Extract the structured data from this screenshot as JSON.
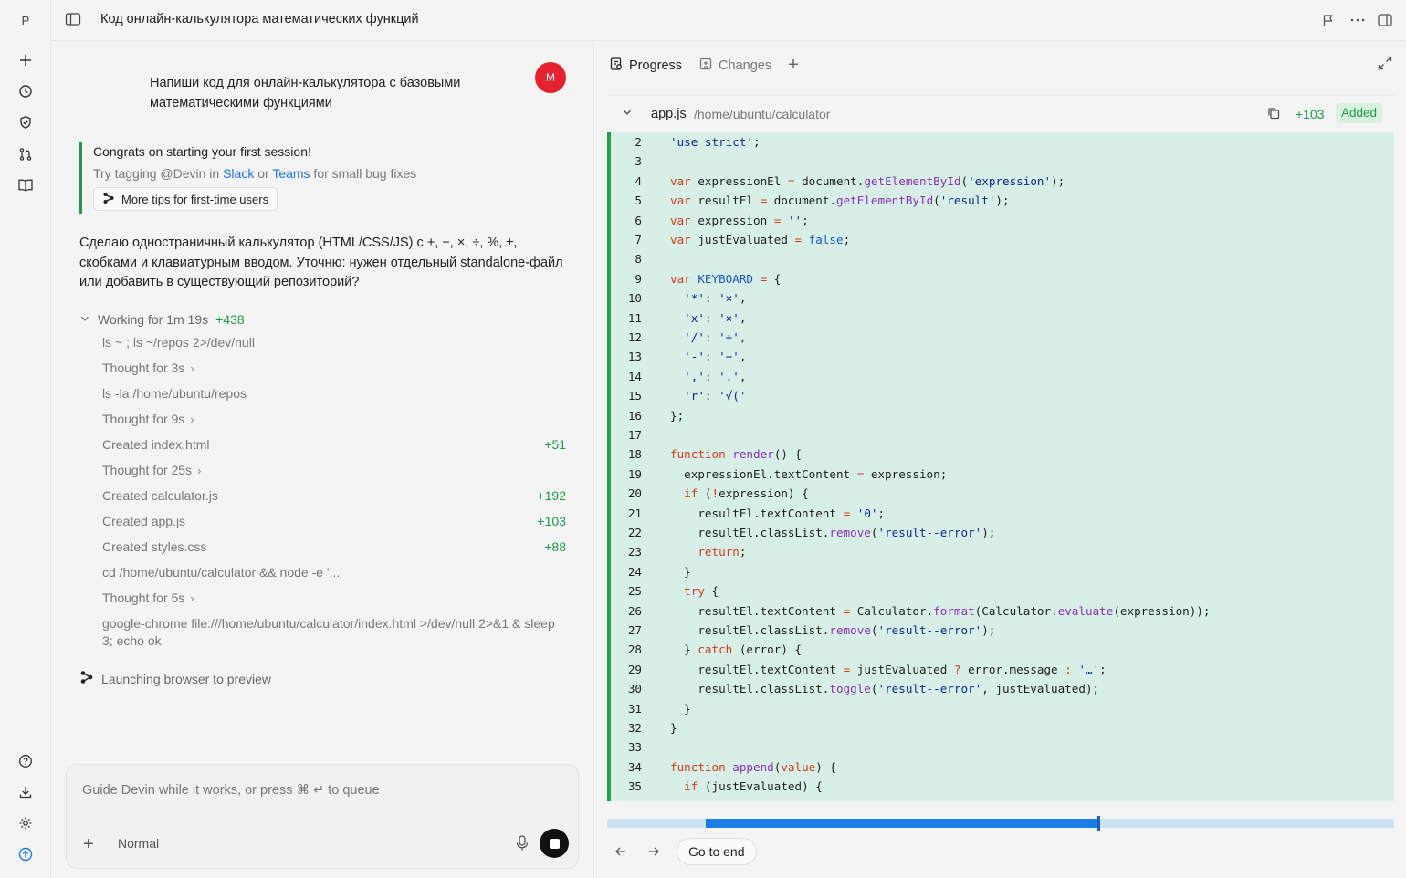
{
  "rail": {
    "workspace_letter": "P",
    "icons": [
      "plus-icon",
      "clock-icon",
      "shield-icon",
      "git-pr-icon",
      "book-icon"
    ],
    "bottom_icons": [
      "help-icon",
      "download-icon",
      "gear-icon",
      "upgrade-icon"
    ]
  },
  "header": {
    "title": "Код онлайн-калькулятора математических функций"
  },
  "chat": {
    "user_message": "Напиши код для онлайн-калькулятора с базовыми математическими функциями",
    "user_avatar": "M",
    "tip": {
      "title": "Congrats on starting your first session!",
      "line_prefix": "Try tagging @Devin in ",
      "slack": "Slack",
      "or": " or ",
      "teams": "Teams",
      "line_suffix": " for small bug fixes",
      "button": "More tips for first-time users"
    },
    "agent_message": "Сделаю одностраничный калькулятор (HTML/CSS/JS) с +, −, ×, ÷, %, ±, скобками и клавиатурным вводом. Уточню: нужен отдельный standalone-файл или добавить в существующий репозиторий?",
    "working": {
      "label": "Working for 1m 19s",
      "plus": "+438"
    },
    "steps": [
      {
        "text": "ls ~ ; ls ~/repos 2>/dev/null",
        "add": "",
        "chevron": false
      },
      {
        "text": "Thought for 3s",
        "add": "",
        "chevron": true
      },
      {
        "text": "ls -la /home/ubuntu/repos",
        "add": "",
        "chevron": false
      },
      {
        "text": "Thought for 9s",
        "add": "",
        "chevron": true
      },
      {
        "text": "Created index.html",
        "add": "+51",
        "chevron": false
      },
      {
        "text": "Thought for 25s",
        "add": "",
        "chevron": true
      },
      {
        "text": "Created calculator.js",
        "add": "+192",
        "chevron": false
      },
      {
        "text": "Created app.js",
        "add": "+103",
        "chevron": false
      },
      {
        "text": "Created styles.css",
        "add": "+88",
        "chevron": false
      },
      {
        "text": "cd /home/ubuntu/calculator && node -e '...'",
        "add": "",
        "chevron": false
      },
      {
        "text": "Thought for 5s",
        "add": "",
        "chevron": true
      },
      {
        "text": "google-chrome file:///home/ubuntu/calculator/index.html >/dev/null 2>&1 & sleep 3; echo ok",
        "add": "",
        "chevron": false
      }
    ],
    "launching": "Launching browser to preview"
  },
  "composer": {
    "placeholder": "Guide Devin while it works, or press ⌘ ↵ to queue",
    "mode": "Normal"
  },
  "panel": {
    "tabs": [
      {
        "label": "Progress",
        "active": true
      },
      {
        "label": "Changes",
        "active": false
      }
    ],
    "file": {
      "name": "app.js",
      "path": "/home/ubuntu/calculator",
      "additions": "+103",
      "badge": "Added"
    },
    "code_lines": [
      {
        "n": "2",
        "html": "<span class=\"st\">'use strict'</span>;"
      },
      {
        "n": "3",
        "html": ""
      },
      {
        "n": "4",
        "html": "<span class=\"kw\">var</span> expressionEl <span class=\"kw\">=</span> document.<span class=\"fn\">getElementById</span>(<span class=\"st\">'expression'</span>);"
      },
      {
        "n": "5",
        "html": "<span class=\"kw\">var</span> resultEl <span class=\"kw\">=</span> document.<span class=\"fn\">getElementById</span>(<span class=\"st\">'result'</span>);"
      },
      {
        "n": "6",
        "html": "<span class=\"kw\">var</span> expression <span class=\"kw\">=</span> <span class=\"st\">''</span>;"
      },
      {
        "n": "7",
        "html": "<span class=\"kw\">var</span> justEvaluated <span class=\"kw\">=</span> <span class=\"cn\">false</span>;"
      },
      {
        "n": "8",
        "html": ""
      },
      {
        "n": "9",
        "html": "<span class=\"kw\">var</span> <span class=\"cn\">KEYBOARD</span> <span class=\"kw\">=</span> {"
      },
      {
        "n": "10",
        "html": "  <span class=\"st\">'*'</span>: <span class=\"st\">'×'</span>,"
      },
      {
        "n": "11",
        "html": "  <span class=\"st\">'x'</span>: <span class=\"st\">'×'</span>,"
      },
      {
        "n": "12",
        "html": "  <span class=\"st\">'/'</span>: <span class=\"st\">'÷'</span>,"
      },
      {
        "n": "13",
        "html": "  <span class=\"st\">'-'</span>: <span class=\"st\">'−'</span>,"
      },
      {
        "n": "14",
        "html": "  <span class=\"st\">','</span>: <span class=\"st\">'.'</span>,"
      },
      {
        "n": "15",
        "html": "  <span class=\"st\">'r'</span>: <span class=\"st\">'√('</span>"
      },
      {
        "n": "16",
        "html": "};"
      },
      {
        "n": "17",
        "html": ""
      },
      {
        "n": "18",
        "html": "<span class=\"kw\">function</span> <span class=\"fn\">render</span>() {"
      },
      {
        "n": "19",
        "html": "  expressionEl.textContent <span class=\"kw\">=</span> expression;"
      },
      {
        "n": "20",
        "html": "  <span class=\"kw\">if</span> (<span class=\"kw\">!</span>expression) {"
      },
      {
        "n": "21",
        "html": "    resultEl.textContent <span class=\"kw\">=</span> <span class=\"st\">'0'</span>;"
      },
      {
        "n": "22",
        "html": "    resultEl.classList.<span class=\"fn\">remove</span>(<span class=\"st\">'result--error'</span>);"
      },
      {
        "n": "23",
        "html": "    <span class=\"kw\">return</span>;"
      },
      {
        "n": "24",
        "html": "  }"
      },
      {
        "n": "25",
        "html": "  <span class=\"kw\">try</span> {"
      },
      {
        "n": "26",
        "html": "    resultEl.textContent <span class=\"kw\">=</span> Calculator.<span class=\"fn\">format</span>(Calculator.<span class=\"fn\">evaluate</span>(expression));"
      },
      {
        "n": "27",
        "html": "    resultEl.classList.<span class=\"fn\">remove</span>(<span class=\"st\">'result--error'</span>);"
      },
      {
        "n": "28",
        "html": "  } <span class=\"kw\">catch</span> (error) {"
      },
      {
        "n": "29",
        "html": "    resultEl.textContent <span class=\"kw\">=</span> justEvaluated <span class=\"kw\">?</span> error.message <span class=\"kw\">:</span> <span class=\"st\">'…'</span>;"
      },
      {
        "n": "30",
        "html": "    resultEl.classList.<span class=\"fn\">toggle</span>(<span class=\"st\">'result--error'</span>, justEvaluated);"
      },
      {
        "n": "31",
        "html": "  }"
      },
      {
        "n": "32",
        "html": "}"
      },
      {
        "n": "33",
        "html": ""
      },
      {
        "n": "34",
        "html": "<span class=\"kw\">function</span> <span class=\"fn\">append</span>(<span class=\"kw\">value</span>) {"
      },
      {
        "n": "35",
        "html": "  <span class=\"kw\">if</span> (justEvaluated) {"
      }
    ],
    "timeline": {
      "start_fraction": 0.125,
      "progress_fraction": 0.625
    },
    "go_to_end": "Go to end"
  },
  "colors": {
    "accent": "#1b7de8",
    "added_green": "#1a9a4a",
    "code_bg": "#d7efe6",
    "user_avatar_bg": "#e5212f"
  }
}
